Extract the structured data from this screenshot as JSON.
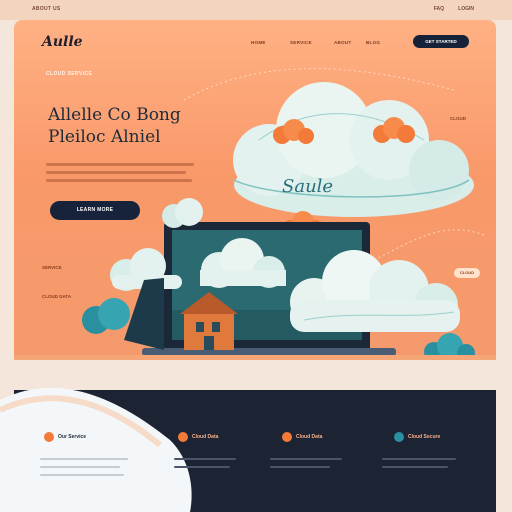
{
  "topbar": {
    "left": "ABOUT US",
    "right_1": "FAQ",
    "right_2": "LOGIN"
  },
  "brand": {
    "logo": "Aulle"
  },
  "nav": {
    "items": [
      "HOME",
      "SERVICE",
      "ABOUT",
      "BLOG"
    ],
    "cta": "GET STARTED"
  },
  "hero": {
    "eyebrow": "CLOUD SERVICE",
    "title_line_1": "Allelle Co Bong",
    "title_line_2": "Pleiloc Alniel",
    "cta": "LEARN MORE",
    "side_label_1": "SERVICE",
    "side_label_2": "CLOUD DATA",
    "pill": "CLOUD",
    "right_tag": "CLOUD",
    "cloud_script": "Saule"
  },
  "features": [
    {
      "title": "Our Service",
      "icon": "orange-dot-icon"
    },
    {
      "title": "Cloud Data",
      "icon": "orange-dot-icon"
    },
    {
      "title": "Cloud Secure",
      "icon": "teal-dot-icon"
    }
  ],
  "colors": {
    "hero_top": "#ffb184",
    "hero_bottom": "#f49a6c",
    "navy": "#17233a",
    "accent": "#f47a3a",
    "teal": "#2a8fa0",
    "footer": "#1c2433"
  }
}
